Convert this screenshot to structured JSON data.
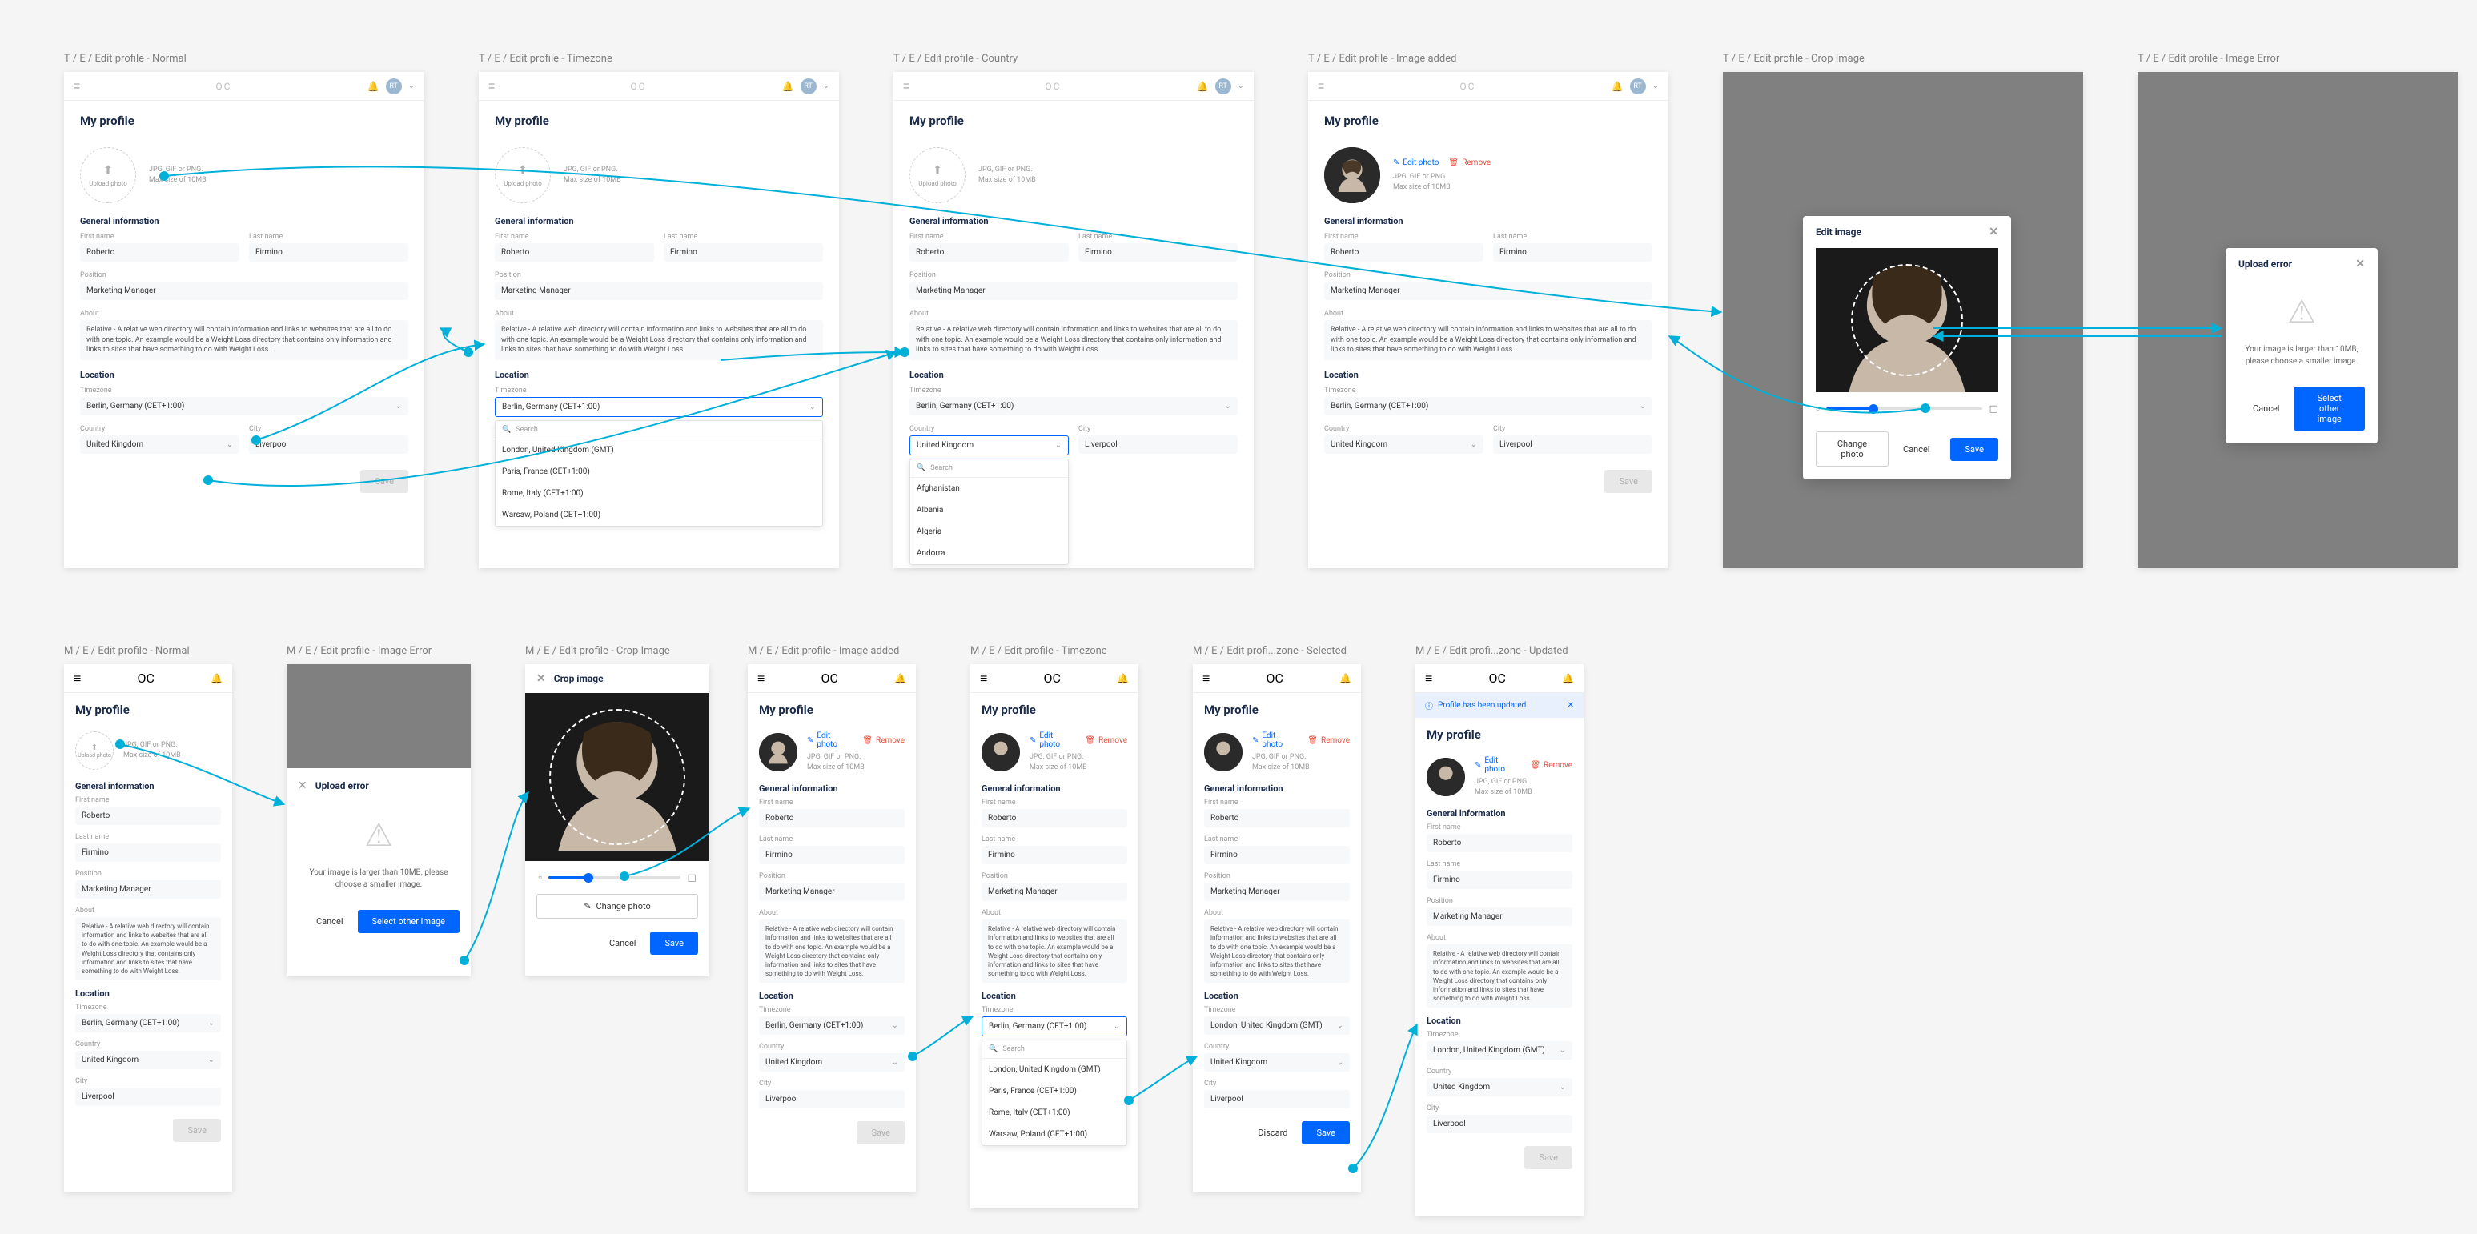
{
  "labels": {
    "t_normal": "T / E / Edit profile - Normal",
    "t_timezone": "T / E / Edit profile - Timezone",
    "t_country": "T / E / Edit profile - Country",
    "t_image_added": "T / E / Edit profile - Image added",
    "t_crop": "T / E / Edit profile - Crop Image",
    "t_error": "T / E / Edit profile - Image Error",
    "m_normal": "M / E / Edit profile - Normal",
    "m_error": "M / E / Edit profile - Image Error",
    "m_crop": "M / E / Edit profile - Crop Image",
    "m_image_added": "M / E / Edit profile - Image added",
    "m_timezone": "M / E / Edit profile - Timezone",
    "m_tz_selected": "M / E / Edit profi...zone - Selected",
    "m_tz_updated": "M / E / Edit profi...zone - Updated"
  },
  "common": {
    "logo": "OC",
    "avatar_initials": "RT",
    "my_profile": "My profile",
    "general_info": "General information",
    "location": "Location",
    "first_name_label": "First name",
    "last_name_label": "Last name",
    "position_label": "Position",
    "about_label": "About",
    "timezone_label": "Timezone",
    "country_label": "Country",
    "city_label": "City",
    "first_name": "Roberto",
    "last_name": "Firmino",
    "position": "Marketing Manager",
    "about": "Relative - A relative web directory will contain information and links to websites that are all to do with one topic. An example would be a Weight Loss directory that contains only information and links to sites that have something to do with Weight Loss.",
    "timezone": "Berlin, Germany (CET+1:00)",
    "timezone_london": "London, United Kingdom (GMT)",
    "country": "United Kingdom",
    "city": "Liverpool",
    "save": "Save",
    "discard": "Discard",
    "cancel": "Cancel",
    "upload_photo": "Upload photo",
    "upload_hint1": "JPG, GIF or PNG.",
    "upload_hint2": "Max size of 10MB",
    "edit_photo": "Edit photo",
    "remove": "Remove",
    "change_photo": "Change photo",
    "search": "Search",
    "select_other_image": "Select other image",
    "upload_error": "Upload error",
    "error_msg": "Your image is larger than 10MB, please choose a smaller image.",
    "edit_image": "Edit image",
    "crop_image": "Crop image",
    "profile_updated": "Profile has been updated"
  },
  "timezone_opts": [
    "London, United Kingdom (GMT)",
    "Paris, France (CET+1:00)",
    "Rome, Italy (CET+1:00)",
    "Warsaw, Poland (CET+1:00)"
  ],
  "country_opts": [
    "Afghanistan",
    "Albania",
    "Algeria",
    "Andorra"
  ]
}
